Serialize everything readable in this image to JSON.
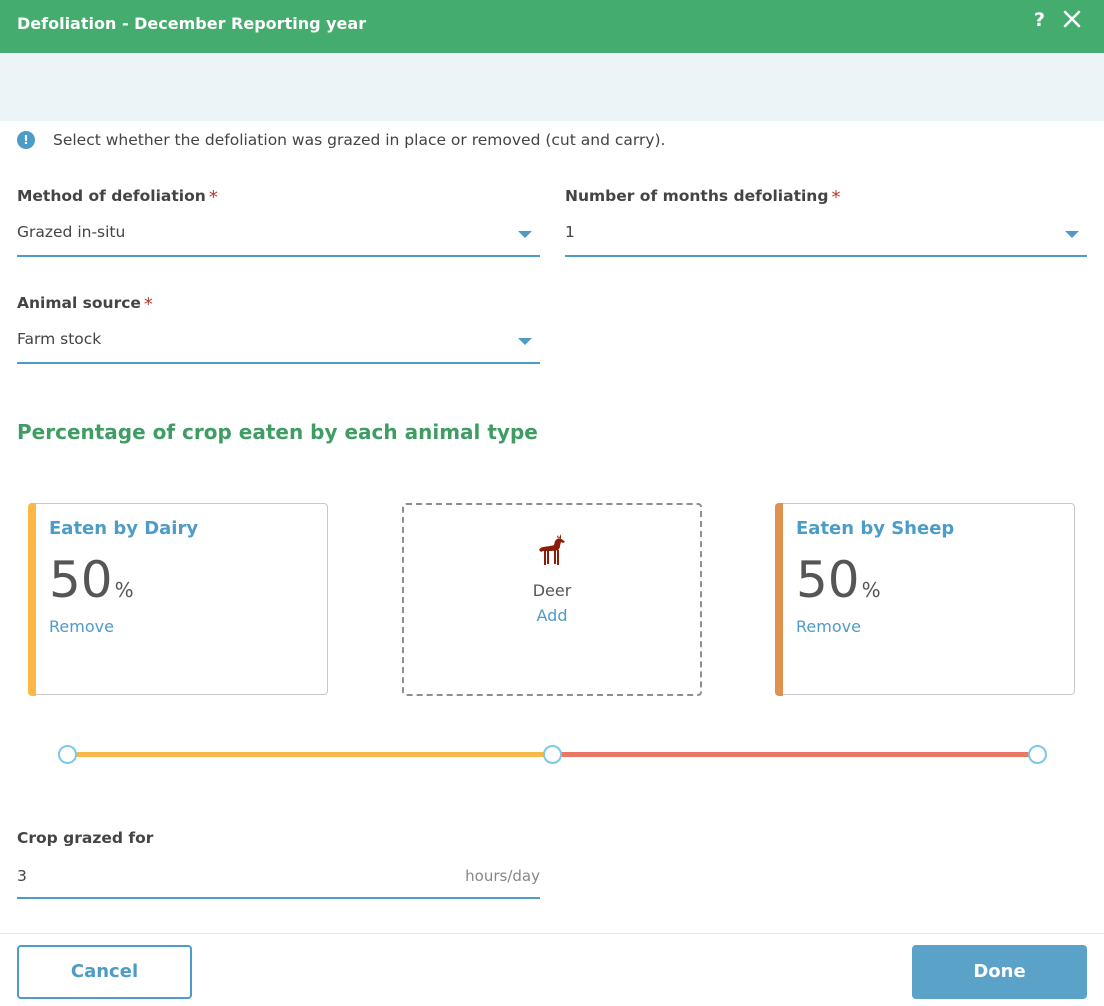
{
  "header": {
    "title": "Defoliation - December Reporting year",
    "help_label": "?"
  },
  "info": {
    "icon": "!",
    "text": "Select whether the defoliation was grazed in place or removed (cut and carry)."
  },
  "fields": {
    "method": {
      "label": "Method of defoliation",
      "required": "*",
      "value": "Grazed in-situ"
    },
    "months": {
      "label": "Number of months defoliating",
      "required": "*",
      "value": "1"
    },
    "source": {
      "label": "Animal source",
      "required": "*",
      "value": "Farm stock"
    }
  },
  "section_title": "Percentage of crop eaten by each animal type",
  "cards": {
    "dairy": {
      "title": "Eaten by Dairy",
      "percent": "50",
      "unit": "%",
      "remove": "Remove",
      "color": "#ffb744"
    },
    "deer": {
      "name": "Deer",
      "add": "Add",
      "icon": "deer-icon"
    },
    "sheep": {
      "title": "Eaten by Sheep",
      "percent": "50",
      "unit": "%",
      "remove": "Remove",
      "color": "#e0914e"
    }
  },
  "slider": {
    "segments": [
      {
        "name": "Dairy",
        "fraction": 0.5,
        "color": "#f8b84a"
      },
      {
        "name": "Sheep",
        "fraction": 0.5,
        "color": "#ea7666"
      }
    ],
    "handle_color": "#7cc8e6"
  },
  "grazed": {
    "label": "Crop grazed for",
    "value": "3",
    "unit": "hours/day"
  },
  "buttons": {
    "cancel": "Cancel",
    "done": "Done"
  }
}
